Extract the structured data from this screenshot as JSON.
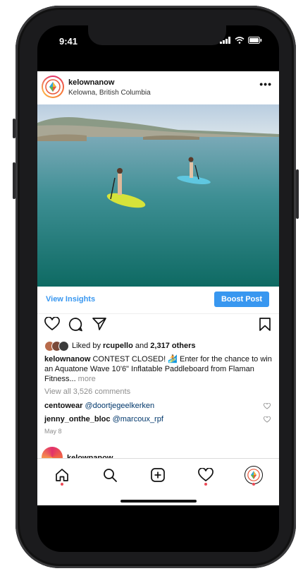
{
  "status_bar": {
    "time": "9:41"
  },
  "post": {
    "username": "kelownanow",
    "location": "Kelowna, British Columbia",
    "more_icon": "more-horizontal-icon",
    "photo_description_icon": "photo-paddleboarders"
  },
  "insights": {
    "view_insights_label": "View Insights",
    "boost_label": "Boost Post"
  },
  "likes": {
    "prefix": "Liked by ",
    "user": "rcupello",
    "middle": " and ",
    "others": "2,317 others"
  },
  "caption": {
    "username": "kelownanow",
    "text": " CONTEST CLOSED! 🏄 Enter for the chance to win an Aquatone Wave 10'6\" Inflatable Paddleboard from Flaman Fitness...",
    "more": " more"
  },
  "comments": {
    "view_all": "View all 3,526 comments",
    "items": [
      {
        "user": "centowear",
        "text": "@doortjegeelkerken"
      },
      {
        "user": "jenny_onthe_bloc",
        "text": "@marcoux_rpf"
      }
    ]
  },
  "date": "May 8",
  "next_post": {
    "username": "kelownanow"
  },
  "colors": {
    "accent": "#3897f0",
    "notification": "#ed4956"
  }
}
